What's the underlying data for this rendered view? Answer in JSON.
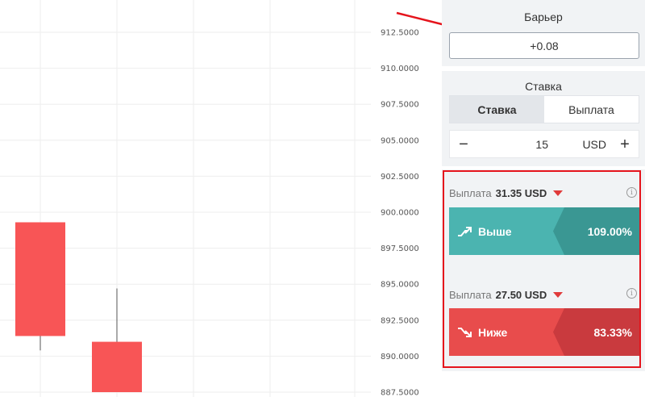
{
  "barrier": {
    "title": "Барьер",
    "value": "+0.08"
  },
  "stake": {
    "title": "Ставка",
    "tabs": [
      {
        "label": "Ставка",
        "active": true
      },
      {
        "label": "Выплата",
        "active": false
      }
    ],
    "minus_label": "−",
    "plus_label": "+",
    "amount": "15",
    "currency": "USD"
  },
  "payouts": [
    {
      "payout_label": "Выплата",
      "payout_value": "31.35 USD",
      "button_label": "Выше",
      "button_percent": "109.00%",
      "direction": "up",
      "color": "#4bb4b0"
    },
    {
      "payout_label": "Выплата",
      "payout_value": "27.50 USD",
      "button_label": "Ниже",
      "button_percent": "83.33%",
      "direction": "down",
      "color": "#e84c4c"
    }
  ],
  "chart_data": {
    "type": "candlestick",
    "y_ticks": [
      "912.5000",
      "910.0000",
      "907.5000",
      "905.0000",
      "902.5000",
      "900.0000",
      "897.5000",
      "895.0000",
      "892.5000",
      "890.0000",
      "887.5000"
    ],
    "ylim": [
      887.5,
      912.5
    ],
    "candles": [
      {
        "open": 899.3,
        "close": 891.4,
        "high": 899.3,
        "low": 890.4,
        "color": "#f85556"
      },
      {
        "open": 891.0,
        "close": 887.5,
        "high": 894.7,
        "low": 887.5,
        "color": "#f85556"
      }
    ],
    "grid": true
  },
  "colors": {
    "up": "#4bb4b0",
    "down": "#e84c4c",
    "highlight": "#e5141c",
    "arrow": "#e5141c"
  }
}
